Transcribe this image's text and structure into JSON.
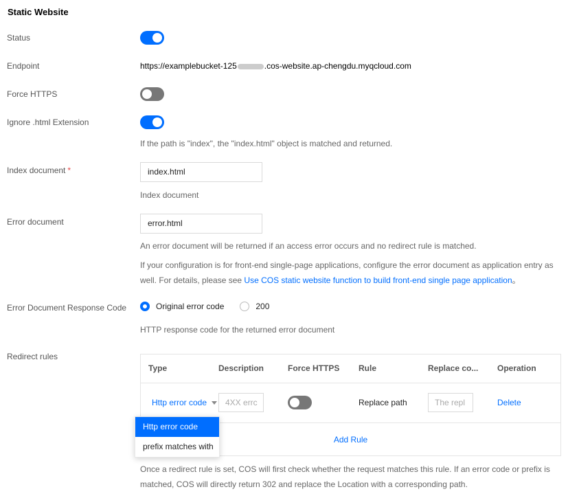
{
  "section_title": "Static Website",
  "status": {
    "label": "Status",
    "enabled": true
  },
  "endpoint": {
    "label": "Endpoint",
    "prefix": "https://examplebucket-125",
    "suffix": ".cos-website.ap-chengdu.myqcloud.com"
  },
  "force_https": {
    "label": "Force HTTPS",
    "enabled": false
  },
  "ignore_html": {
    "label": "Ignore .html Extension",
    "enabled": true,
    "help": "If the path is \"index\", the \"index.html\" object is matched and returned."
  },
  "index_document": {
    "label": "Index document",
    "required_mark": "*",
    "value": "index.html",
    "help": "Index document"
  },
  "error_document": {
    "label": "Error document",
    "value": "error.html",
    "help1": "An error document will be returned if an access error occurs and no redirect rule is matched.",
    "help2": "If your configuration is for front-end single-page applications, configure the error document as application entry as well. For details, please see ",
    "help2_link": "Use COS static website function to build front-end single page application",
    "help2_end": "。"
  },
  "error_response_code": {
    "label": "Error Document Response Code",
    "options": [
      "Original error code",
      "200"
    ],
    "selected": "Original error code",
    "help": "HTTP response code for the returned error document"
  },
  "redirect_rules": {
    "label": "Redirect rules",
    "columns": [
      "Type",
      "Description",
      "Force HTTPS",
      "Rule",
      "Replace co...",
      "Operation"
    ],
    "row": {
      "type": "Http error code",
      "description_placeholder": "4XX errc",
      "force_https": false,
      "rule": "Replace path",
      "replace_placeholder": "The repl",
      "operation": "Delete"
    },
    "add_rule": "Add Rule",
    "dropdown_options": [
      "Http error code",
      "prefix matches with"
    ],
    "dropdown_selected": "Http error code",
    "help": "Once a redirect rule is set, COS will first check whether the request matches this rule. If an error code or prefix is matched, COS will directly return 302 and replace the Location with a corresponding path."
  },
  "colors": {
    "accent": "#006eff",
    "toggle_off": "#777777",
    "required": "#e54545"
  }
}
